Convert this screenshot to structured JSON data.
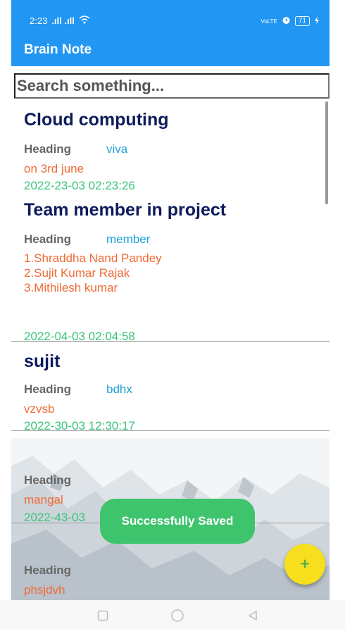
{
  "status": {
    "time": "2:23",
    "signal": ".ıll .ıll",
    "volte": "VoLTE",
    "battery": "71"
  },
  "app": {
    "title": "Brain Note"
  },
  "search": {
    "placeholder": "Search something..."
  },
  "notes": [
    {
      "title": "Cloud computing",
      "heading_label": "Heading",
      "heading_value": "viva",
      "body": "on 3rd june",
      "date": "2022-23-03 02:23:26"
    },
    {
      "title": "Team member in project",
      "heading_label": "Heading",
      "heading_value": "member",
      "body": "1.Shraddha Nand Pandey\n2.Sujit Kumar Rajak\n3.Mithilesh kumar",
      "date": "2022-04-03 02:04:58"
    },
    {
      "title": "sujit",
      "heading_label": "Heading",
      "heading_value": "bdhx",
      "body": "vzvsb",
      "date": "2022-30-03 12:30:17"
    },
    {
      "heading_label": "Heading",
      "body": "mangal",
      "date": "2022-43-03"
    },
    {
      "heading_label": "Heading",
      "body": "phsjdvh"
    }
  ],
  "toast": {
    "text": "Successfully Saved"
  },
  "fab": {
    "label": "+"
  },
  "icons": {
    "fab": "add-icon",
    "wifi": "wifi-icon",
    "alarm": "alarm-icon",
    "charging": "charging-icon"
  },
  "colors": {
    "primary": "#2196F3",
    "title": "#0d1b5c",
    "heading_value": "#1fa3d9",
    "body": "#f06a35",
    "date": "#39c47a",
    "toast": "#3ec46d",
    "fab": "#f7df1e"
  }
}
